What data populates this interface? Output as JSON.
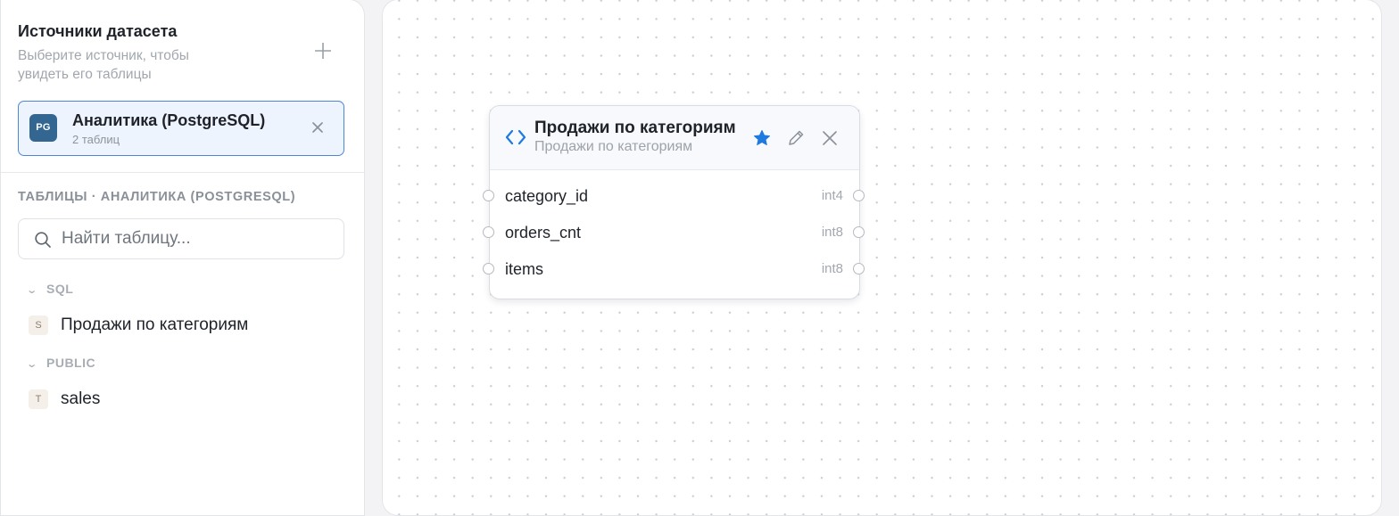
{
  "sidebar": {
    "sources": {
      "title": "Источники датасета",
      "subtitle": "Выберите источник, чтобы увидеть его таблицы",
      "add_icon": "plus-icon",
      "selected": {
        "badge": "PG",
        "name": "Аналитика (PostgreSQL)",
        "count": "2 таблиц",
        "close_icon": "close-icon",
        "badge_color": "#336792"
      }
    },
    "tables": {
      "title": "ТАБЛИЦЫ · АНАЛИТИКА (POSTGRESQL)",
      "search_placeholder": "Найти таблицу...",
      "groups": [
        {
          "name": "SQL",
          "items": [
            {
              "badge": "S",
              "label": "Продажи по категориям"
            }
          ]
        },
        {
          "name": "PUBLIC",
          "items": [
            {
              "badge": "T",
              "label": "sales"
            }
          ]
        }
      ]
    }
  },
  "canvas": {
    "node": {
      "title": "Продажи по категориям",
      "subtitle": "Продажи по категориям",
      "icons": [
        "code-icon",
        "star-icon",
        "pencil-icon",
        "close-icon"
      ],
      "star_color": "#1f7ae0",
      "columns": [
        {
          "name": "category_id",
          "type": "int4"
        },
        {
          "name": "orders_cnt",
          "type": "int8"
        },
        {
          "name": "items",
          "type": "int8"
        }
      ]
    }
  },
  "colors": {
    "accent": "#4e86d6",
    "selected_bg": "#edf4fd"
  }
}
